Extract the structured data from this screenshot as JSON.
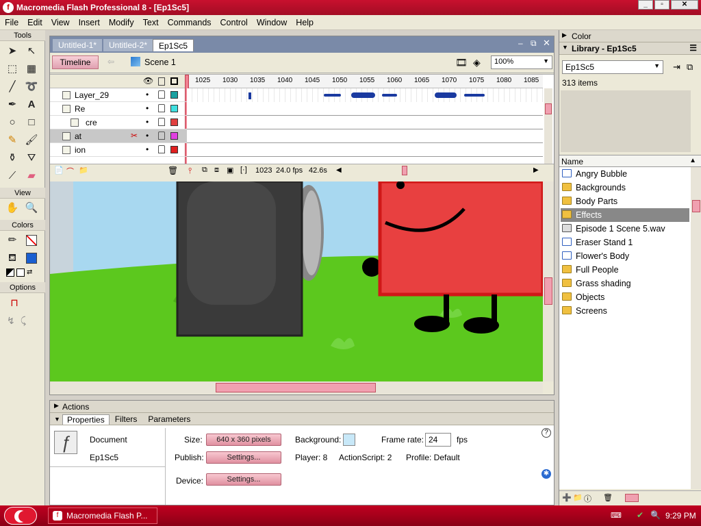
{
  "window": {
    "title": "Macromedia Flash Professional 8 - [Ep1Sc5]"
  },
  "menu": [
    "File",
    "Edit",
    "View",
    "Insert",
    "Modify",
    "Text",
    "Commands",
    "Control",
    "Window",
    "Help"
  ],
  "tools": {
    "section_tools": "Tools",
    "section_view": "View",
    "section_colors": "Colors",
    "section_options": "Options"
  },
  "doc_tabs": [
    "Untitled-1*",
    "Untitled-2*",
    "Ep1Sc5"
  ],
  "edit_bar": {
    "timeline_btn": "Timeline",
    "scene": "Scene 1",
    "zoom": "100%"
  },
  "timeline": {
    "ruler": [
      "1025",
      "1030",
      "1035",
      "1040",
      "1045",
      "1050",
      "1055",
      "1060",
      "1065",
      "1070",
      "1075",
      "1080",
      "1085"
    ],
    "layers": [
      {
        "name": "Layer_29",
        "color": "#1aa0a0"
      },
      {
        "name": "Re",
        "color": "#40e0e0"
      },
      {
        "name": "cre",
        "color": "#e04040"
      },
      {
        "name": "at",
        "color": "#e040e0"
      },
      {
        "name": "ion",
        "color": "#e02020"
      }
    ],
    "status": {
      "frame": "1023",
      "fps": "24.0 fps",
      "time": "42.6s"
    }
  },
  "actions_panel": {
    "title": "Actions"
  },
  "properties": {
    "tabs": [
      "Properties",
      "Filters",
      "Parameters"
    ],
    "doc_label": "Document",
    "doc_name": "Ep1Sc5",
    "size_label": "Size:",
    "size_value": "640 x 360 pixels",
    "background_label": "Background:",
    "framerate_label": "Frame rate:",
    "framerate_value": "24",
    "fps_label": "fps",
    "publish_label": "Publish:",
    "settings_btn": "Settings...",
    "player": "Player: 8",
    "actionscript": "ActionScript: 2",
    "profile": "Profile: Default",
    "device_label": "Device:",
    "device_btn": "Settings..."
  },
  "color_panel": {
    "title": "Color"
  },
  "library": {
    "title": "Library - Ep1Sc5",
    "doc_select": "Ep1Sc5",
    "count": "313 items",
    "col_name": "Name",
    "items": [
      {
        "name": "Angry Bubble",
        "kind": "symbol"
      },
      {
        "name": "Backgrounds",
        "kind": "folder"
      },
      {
        "name": "Body Parts",
        "kind": "folder"
      },
      {
        "name": "Effects",
        "kind": "folder",
        "selected": true
      },
      {
        "name": "Episode 1 Scene 5.wav",
        "kind": "sound"
      },
      {
        "name": "Eraser Stand 1",
        "kind": "symbol"
      },
      {
        "name": "Flower's Body",
        "kind": "symbol"
      },
      {
        "name": "Full People",
        "kind": "folder"
      },
      {
        "name": "Grass shading",
        "kind": "folder"
      },
      {
        "name": "Objects",
        "kind": "folder"
      },
      {
        "name": "Screens",
        "kind": "folder"
      }
    ]
  },
  "taskbar": {
    "app_button": "Macromedia Flash P...",
    "clock": "9:29 PM"
  },
  "colors": {
    "title_bar": "#c8102e",
    "taskbar": "#a30d24",
    "stage_grass": "#5cc81e",
    "stage_sky": "#a8d8f0",
    "red_character": "#e84040"
  }
}
